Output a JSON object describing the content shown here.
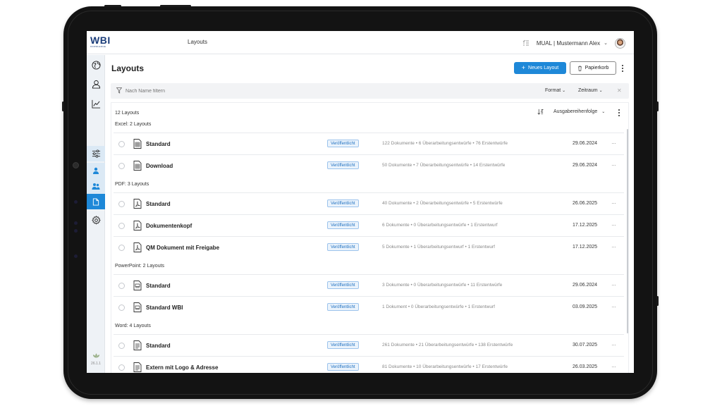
{
  "topbar": {
    "logo_text": "WBI",
    "logo_sub": "KNOWLEDGE",
    "breadcrumb": "Layouts",
    "user_label": "MUAL | Mustermann Alex"
  },
  "sidebar": {
    "version": "26.1.1",
    "icons": [
      "globe-icon",
      "user-icon",
      "chart-icon",
      "sliders-icon",
      "person-icon",
      "people-icon",
      "document-icon",
      "gear-icon"
    ]
  },
  "page": {
    "title": "Layouts",
    "new_button": "Neues Layout",
    "trash_button": "Papierkorb"
  },
  "filter": {
    "placeholder": "Nach Name filtern",
    "format_label": "Format",
    "period_label": "Zeitraum"
  },
  "list": {
    "count": "12 Layouts",
    "sort_label": "Ausgabereihenfolge",
    "groups": [
      {
        "label": "Excel: 2 Layouts",
        "type": "excel",
        "items": [
          {
            "name": "Standard",
            "status": "Veröffentlicht",
            "stats": "122 Dokumente • 6 Überarbeitungsentwürfe • 76 Erstentwürfe",
            "date": "29.06.2024"
          },
          {
            "name": "Download",
            "status": "Veröffentlicht",
            "stats": "50 Dokumente • 7 Überarbeitungsentwürfe • 14 Erstentwürfe",
            "date": "29.06.2024"
          }
        ]
      },
      {
        "label": "PDF: 3 Layouts",
        "type": "pdf",
        "items": [
          {
            "name": "Standard",
            "status": "Veröffentlicht",
            "stats": "40 Dokumente • 2 Überarbeitungsentwürfe • 5 Erstentwürfe",
            "date": "26.06.2025"
          },
          {
            "name": "Dokumentenkopf",
            "status": "Veröffentlicht",
            "stats": "6 Dokumente • 0 Überarbeitungsentwürfe • 1 Erstentwurf",
            "date": "17.12.2025"
          },
          {
            "name": "QM Dokument mit Freigabe",
            "status": "Veröffentlicht",
            "stats": "5 Dokumente • 1 Überarbeitungsentwurf • 1 Erstentwurf",
            "date": "17.12.2025"
          }
        ]
      },
      {
        "label": "PowerPoint: 2 Layouts",
        "type": "ppt",
        "items": [
          {
            "name": "Standard",
            "status": "Veröffentlicht",
            "stats": "3 Dokumente • 0 Überarbeitungsentwürfe • 11 Erstentwürfe",
            "date": "29.06.2024"
          },
          {
            "name": "Standard WBI",
            "status": "Veröffentlicht",
            "stats": "1 Dokument • 0 Überarbeitungsentwürfe • 1 Erstentwurf",
            "date": "03.09.2025"
          }
        ]
      },
      {
        "label": "Word: 4 Layouts",
        "type": "word",
        "items": [
          {
            "name": "Standard",
            "status": "Veröffentlicht",
            "stats": "261 Dokumente • 21 Überarbeitungsentwürfe • 138 Erstentwürfe",
            "date": "30.07.2025"
          },
          {
            "name": "Extern mit Logo & Adresse",
            "status": "Veröffentlicht",
            "stats": "81 Dokumente • 10 Überarbeitungsentwürfe • 17 Erstentwürfe",
            "date": "26.03.2025"
          }
        ]
      }
    ]
  }
}
